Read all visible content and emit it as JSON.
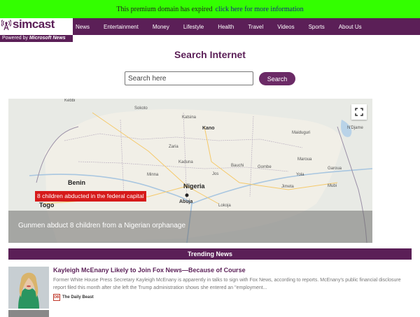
{
  "promo": {
    "text": "This premium domain has expired",
    "link": "click here for more information"
  },
  "brand": {
    "logo": "simcast",
    "powered_prefix": "Powered by",
    "powered_brand": "Microsoft News"
  },
  "nav": {
    "items": [
      "News",
      "Entertainment",
      "Money",
      "Lifestyle",
      "Health",
      "Travel",
      "Videos",
      "Sports",
      "About Us"
    ]
  },
  "search": {
    "title": "Search Internet",
    "placeholder": "Search here",
    "button": "Search"
  },
  "featured": {
    "map_label": "8 children abducted in the federal capital",
    "headline": "Gunmen abduct 8 children from a Nigerian orphanage",
    "places": {
      "nigeria": "Nigeria",
      "benin": "Benin",
      "togo": "Togo",
      "abuja": "Abuja",
      "kano": "Kano",
      "kaduna": "Kaduna",
      "sokoto": "Sokoto",
      "katsina": "Katsina",
      "zaria": "Zaria",
      "maiduguri": "Maiduguri",
      "ndjamena": "N'Djame",
      "bauchi": "Bauchi",
      "jos": "Jos",
      "gombe": "Gombe",
      "yola": "Yola",
      "jimeta": "Jimeta",
      "maroua": "Maroua",
      "garoua": "Garoua",
      "minna": "Minna",
      "kebbi": "Kebbi",
      "lokoja": "Lokoja",
      "mubi": "Mubi"
    }
  },
  "trending": {
    "header": "Trending News",
    "articles": [
      {
        "title": "Kayleigh McEnany Likely to Join Fox News—Because of Course",
        "snippet": "Former White House Press Secretary Kayleigh McEnany is apparently in talks to sign with Fox News, according to reports. McEnany's public financial disclosure report filed this month after she left the Trump administration shows she entered an \"employment...",
        "source": "The Daily Beast",
        "source_logo": "DB"
      }
    ]
  },
  "colors": {
    "brand": "#5b1f57",
    "promo_bg": "#33ff00",
    "alert_red": "#d61a1a"
  }
}
